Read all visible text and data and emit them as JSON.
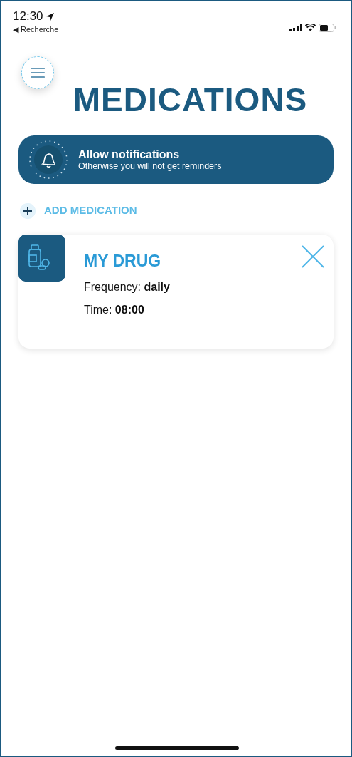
{
  "status_bar": {
    "time": "12:30",
    "back_link": "◀ Recherche"
  },
  "title": "MEDICATIONS",
  "notification_banner": {
    "title": "Allow notifications",
    "subtitle": "Otherwise you will not get reminders"
  },
  "add_button": {
    "label": "ADD MEDICATION"
  },
  "medications": [
    {
      "name": "MY DRUG",
      "details": [
        "Frequency: **daily**",
        "Time: **08:00**"
      ]
    }
  ]
}
